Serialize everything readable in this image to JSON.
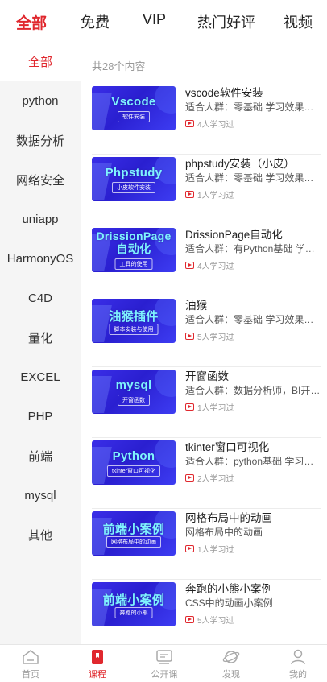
{
  "colors": {
    "accent": "#e0282e",
    "thumb_blue": "#3a2ee8",
    "thumb_text": "#7ff3ff"
  },
  "top_tabs": [
    "全部",
    "免费",
    "VIP",
    "热门好评",
    "视频"
  ],
  "sidebar": [
    "全部",
    "python",
    "数据分析",
    "网络安全",
    "uniapp",
    "HarmonyOS",
    "C4D",
    "量化",
    "EXCEL",
    "PHP",
    "前端",
    "mysql",
    "其他"
  ],
  "count_text": "共28个内容",
  "courses": [
    {
      "thumb_title": "Vscode",
      "thumb_sub": "软件安装",
      "title": "vscode软件安装",
      "desc": "适合人群：零基础 学习效果：学会vscode软件安装",
      "learners": "4人学习过"
    },
    {
      "thumb_title": "Phpstudy",
      "thumb_sub": "小皮软件安装",
      "title": "phpstudy安装（小皮）",
      "desc": "适合人群：零基础 学习效果：学会phpstudy安装",
      "learners": "1人学习过"
    },
    {
      "thumb_title": "DrissionPage自动化",
      "thumb_sub": "工具的使用",
      "title": "DrissionPage自动化",
      "desc": "适合人群：有Python基础 学习效果：学会自动化",
      "learners": "4人学习过"
    },
    {
      "thumb_title": "油猴插件",
      "thumb_sub": "脚本安装与使用",
      "title": "油猴",
      "desc": "适合人群：零基础 学习效果：可以使用油猴脚本",
      "learners": "5人学习过"
    },
    {
      "thumb_title": "mysql",
      "thumb_sub": "开窗函数",
      "title": "开窗函数",
      "desc": "适合人群：数据分析师，BI开发人员",
      "learners": "1人学习过"
    },
    {
      "thumb_title": "Python",
      "thumb_sub": "tkinter窗口可视化",
      "title": "tkinter窗口可视化",
      "desc": "适合人群：python基础 学习效果：学会窗口可视化",
      "learners": "2人学习过"
    },
    {
      "thumb_title": "前端小案例",
      "thumb_sub": "网格布局中的动画",
      "title": "网格布局中的动画",
      "desc": "网格布局中的动画",
      "learners": "1人学习过"
    },
    {
      "thumb_title": "前端小案例",
      "thumb_sub": "奔跑的小熊",
      "title": "奔跑的小熊小案例",
      "desc": "CSS中的动画小案例",
      "learners": "5人学习过"
    }
  ],
  "bottom_nav": [
    {
      "label": "首页",
      "icon": "home-icon"
    },
    {
      "label": "课程",
      "icon": "bookmark-icon"
    },
    {
      "label": "公开课",
      "icon": "screen-icon"
    },
    {
      "label": "发现",
      "icon": "planet-icon"
    },
    {
      "label": "我的",
      "icon": "profile-icon"
    }
  ]
}
